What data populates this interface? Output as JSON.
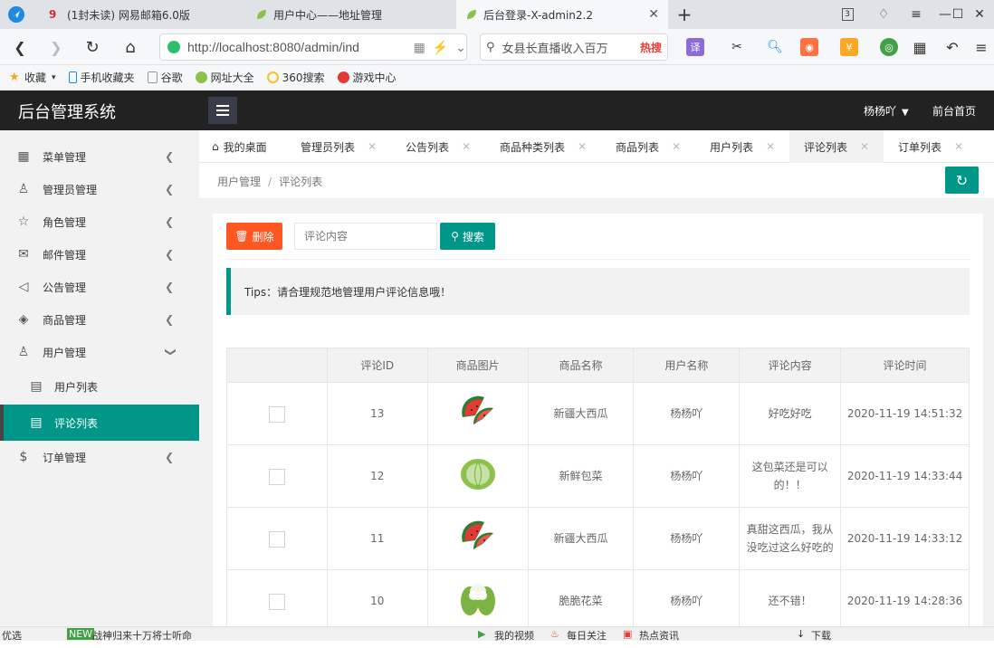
{
  "browser": {
    "tabs": [
      {
        "title": "(1封未读) 网易邮箱6.0版"
      },
      {
        "title": "用户中心——地址管理"
      },
      {
        "title": "后台登录-X-admin2.2"
      }
    ],
    "new_tab": "+",
    "url": "http://localhost:8080/admin/ind",
    "search_text": "女县长直播收入百万",
    "search_hot": "热搜",
    "bookmarks": [
      "收藏",
      "手机收藏夹",
      "谷歌",
      "网址大全",
      "360搜索",
      "游戏中心"
    ],
    "status_left": "优选",
    "status_news": "战神归来十万将士听命",
    "status_items": [
      "我的视频",
      "每日关注",
      "热点资讯",
      "下载"
    ]
  },
  "app": {
    "brand": "后台管理系统",
    "user": "杨杨吖",
    "front_link": "前台首页"
  },
  "sidebar": {
    "items": [
      {
        "label": "菜单管理",
        "icon": "grid-icon"
      },
      {
        "label": "管理员管理",
        "icon": "user-icon"
      },
      {
        "label": "角色管理",
        "icon": "star-icon"
      },
      {
        "label": "邮件管理",
        "icon": "mail-icon"
      },
      {
        "label": "公告管理",
        "icon": "speaker-icon"
      },
      {
        "label": "商品管理",
        "icon": "box-icon"
      },
      {
        "label": "用户管理",
        "icon": "user-icon"
      },
      {
        "label": "用户列表",
        "icon": "list-icon"
      },
      {
        "label": "评论列表",
        "icon": "list-icon"
      },
      {
        "label": "订单管理",
        "icon": "dollar-icon"
      }
    ]
  },
  "page_tabs": [
    "我的桌面",
    "管理员列表",
    "公告列表",
    "商品种类列表",
    "商品列表",
    "用户列表",
    "评论列表",
    "订单列表"
  ],
  "breadcrumb": {
    "parent": "用户管理",
    "sep": "/",
    "current": "评论列表"
  },
  "toolbar": {
    "delete_label": "删除",
    "search_placeholder": "评论内容",
    "search_label": "搜索"
  },
  "tips": "Tips：请合理规范地管理用户评论信息哦！",
  "table": {
    "headers": [
      "",
      "评论ID",
      "商品图片",
      "商品名称",
      "用户名称",
      "评论内容",
      "评论时间"
    ],
    "rows": [
      {
        "id": "13",
        "image": "watermelon",
        "product": "新疆大西瓜",
        "user": "杨杨吖",
        "content": "好吃好吃",
        "time": "2020-11-19 14:51:32"
      },
      {
        "id": "12",
        "image": "cabbage",
        "product": "新鲜包菜",
        "user": "杨杨吖",
        "content": "这包菜还是可以的！！",
        "time": "2020-11-19 14:33:44"
      },
      {
        "id": "11",
        "image": "watermelon",
        "product": "新疆大西瓜",
        "user": "杨杨吖",
        "content": "真甜这西瓜，我从没吃过这么好吃的",
        "time": "2020-11-19 14:33:12"
      },
      {
        "id": "10",
        "image": "cauliflower",
        "product": "脆脆花菜",
        "user": "杨杨吖",
        "content": "还不错！",
        "time": "2020-11-19 14:28:36"
      }
    ]
  },
  "colors": {
    "accent": "#009688",
    "danger": "#ff5722",
    "topbar": "#222222",
    "sidebar": "#f2f2f2"
  }
}
